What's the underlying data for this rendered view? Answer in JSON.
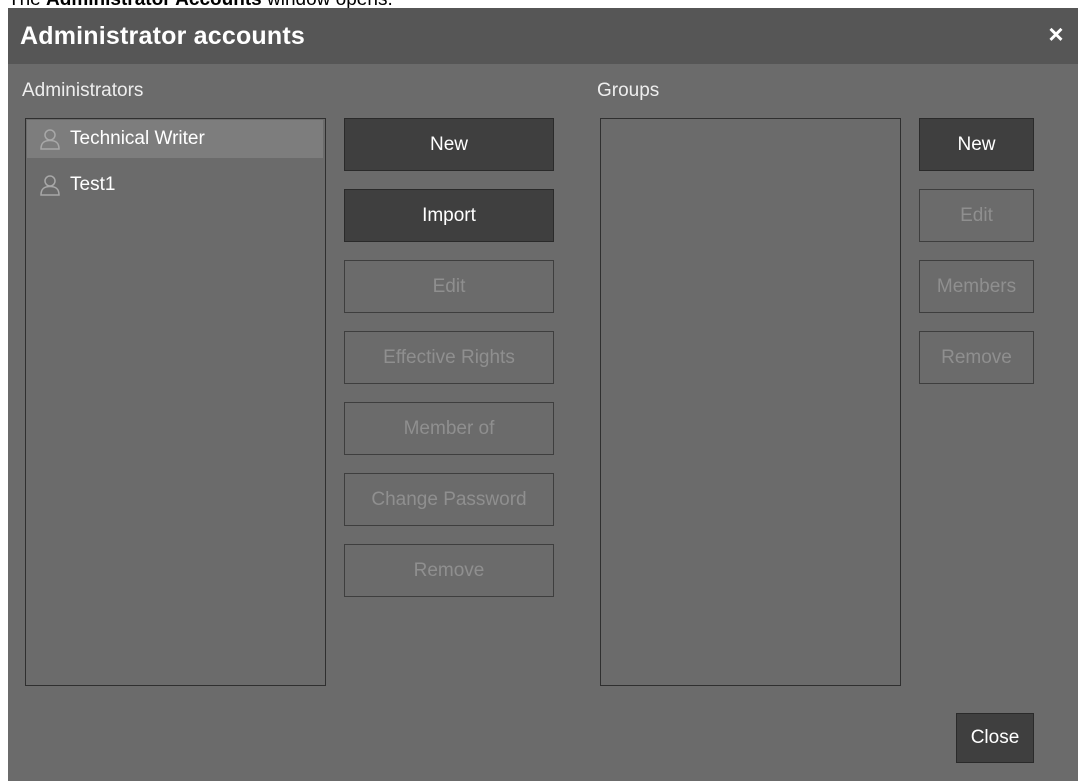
{
  "caption": {
    "prefix": "The ",
    "bold": "Administrator Accounts",
    "suffix": " window opens."
  },
  "dialog": {
    "title": "Administrator accounts",
    "close_icon": "×"
  },
  "administrators": {
    "label": "Administrators",
    "items": [
      {
        "name": "Technical Writer",
        "selected": true,
        "icon": "user-icon"
      },
      {
        "name": "Test1",
        "selected": false,
        "icon": "user-icon"
      }
    ],
    "buttons": {
      "new": "New",
      "import": "Import",
      "edit": "Edit",
      "effective_rights": "Effective Rights",
      "member_of": "Member of",
      "change_password": "Change Password",
      "remove": "Remove"
    }
  },
  "groups": {
    "label": "Groups",
    "items": [],
    "buttons": {
      "new": "New",
      "edit": "Edit",
      "members": "Members",
      "remove": "Remove"
    }
  },
  "footer": {
    "close": "Close"
  },
  "colors": {
    "dialog_bg": "#6b6b6b",
    "titlebar_bg": "#565656",
    "button_enabled_bg": "#3f3f3f",
    "button_disabled_text": "#8f8f8f",
    "selected_row_bg": "#7d7d7d"
  }
}
